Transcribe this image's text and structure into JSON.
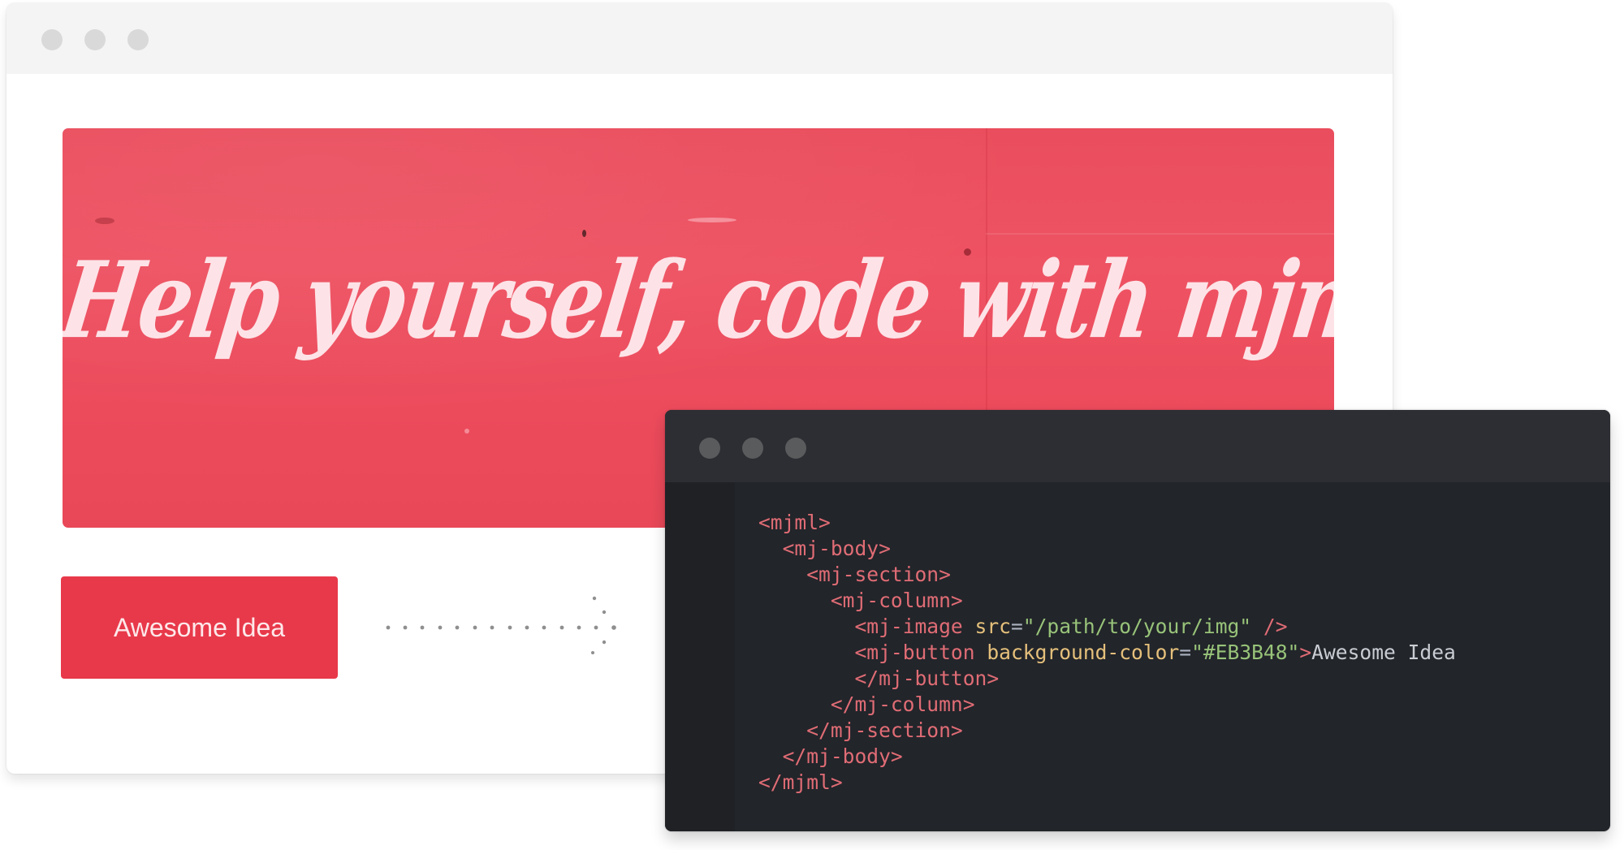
{
  "preview": {
    "window_controls": [
      "close",
      "minimize",
      "maximize"
    ],
    "hero": {
      "headline": "Help yourself, code with mjml",
      "text_color": "#fde3e7",
      "background_color": "#ec4c5c"
    },
    "button": {
      "label": "Awesome Idea",
      "background_color": "#e8394a"
    },
    "arrow_icon": "dotted-arrow-right-icon"
  },
  "editor": {
    "window_controls": [
      "close",
      "minimize",
      "maximize"
    ],
    "colors": {
      "tag": "#e06c75",
      "attribute": "#e5c07b",
      "string": "#98c379",
      "text": "#c9ccd2"
    },
    "lines": [
      {
        "indent": 0,
        "tokens": [
          {
            "t": "tag",
            "v": "<mjml>"
          }
        ]
      },
      {
        "indent": 1,
        "tokens": [
          {
            "t": "tag",
            "v": "<mj-body>"
          }
        ]
      },
      {
        "indent": 2,
        "tokens": [
          {
            "t": "tag",
            "v": "<mj-section>"
          }
        ]
      },
      {
        "indent": 3,
        "tokens": [
          {
            "t": "tag",
            "v": "<mj-column>"
          }
        ]
      },
      {
        "indent": 4,
        "tokens": [
          {
            "t": "tag",
            "v": "<mj-image"
          },
          {
            "t": "text",
            "v": " "
          },
          {
            "t": "attr",
            "v": "src"
          },
          {
            "t": "eq",
            "v": "="
          },
          {
            "t": "str",
            "v": "\"/path/to/your/img\""
          },
          {
            "t": "text",
            "v": " "
          },
          {
            "t": "tag",
            "v": "/>"
          }
        ]
      },
      {
        "indent": 4,
        "tokens": [
          {
            "t": "tag",
            "v": "<mj-button"
          },
          {
            "t": "text",
            "v": " "
          },
          {
            "t": "attr",
            "v": "background-color"
          },
          {
            "t": "eq",
            "v": "="
          },
          {
            "t": "str",
            "v": "\"#EB3B48\""
          },
          {
            "t": "tag",
            "v": ">"
          },
          {
            "t": "text",
            "v": "Awesome Idea"
          }
        ]
      },
      {
        "indent": 4,
        "tokens": [
          {
            "t": "tag",
            "v": "</mj-button>"
          }
        ]
      },
      {
        "indent": 3,
        "tokens": [
          {
            "t": "tag",
            "v": "</mj-column>"
          }
        ]
      },
      {
        "indent": 2,
        "tokens": [
          {
            "t": "tag",
            "v": "</mj-section>"
          }
        ]
      },
      {
        "indent": 1,
        "tokens": [
          {
            "t": "tag",
            "v": "</mj-body>"
          }
        ]
      },
      {
        "indent": 0,
        "tokens": [
          {
            "t": "tag",
            "v": "</mjml>"
          }
        ]
      }
    ]
  }
}
